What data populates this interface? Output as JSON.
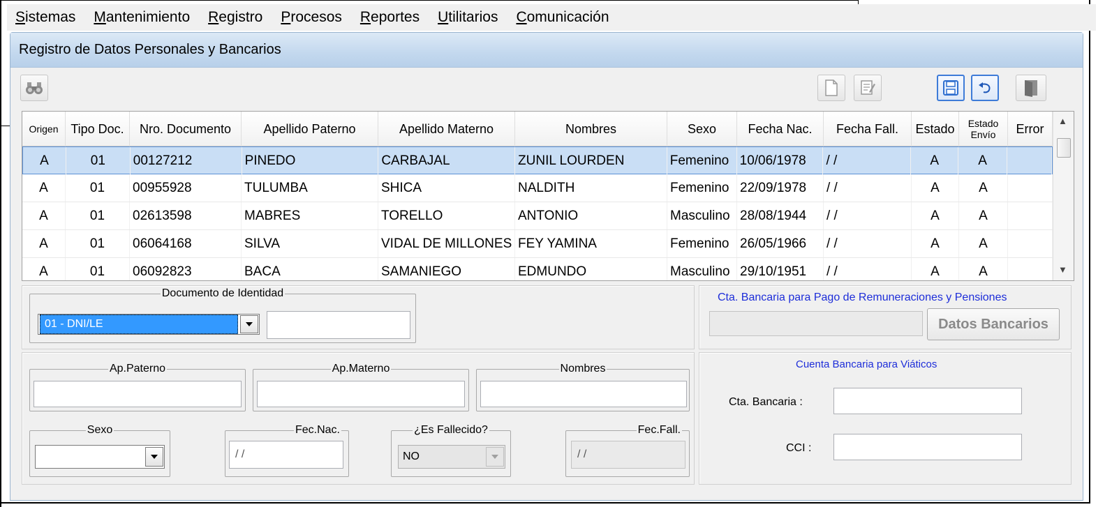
{
  "menu": [
    {
      "u": "S",
      "rest": "istemas"
    },
    {
      "u": "M",
      "rest": "antenimiento"
    },
    {
      "u": "R",
      "rest": "egistro"
    },
    {
      "u": "P",
      "rest": "rocesos"
    },
    {
      "u": "R",
      "rest": "eportes"
    },
    {
      "u": "U",
      "rest": "tilitarios"
    },
    {
      "u": "C",
      "rest": "omunicación"
    }
  ],
  "window": {
    "title": "Registro de Datos Personales y Bancarios"
  },
  "grid": {
    "headers": [
      "Origen",
      "Tipo Doc.",
      "Nro. Documento",
      "Apellido Paterno",
      "Apellido Materno",
      "Nombres",
      "Sexo",
      "Fecha Nac.",
      "Fecha Fall.",
      "Estado",
      "Estado Envío",
      "Error"
    ],
    "estado_envio_line1": "Estado",
    "estado_envio_line2": "Envío",
    "rows": [
      [
        "A",
        "01",
        "00127212",
        "PINEDO",
        "CARBAJAL",
        "ZUNIL LOURDEN",
        "Femenino",
        "10/06/1978",
        "/ /",
        "A",
        "A",
        ""
      ],
      [
        "A",
        "01",
        "00955928",
        "TULUMBA",
        "SHICA",
        "NALDITH",
        "Femenino",
        "22/09/1978",
        "/ /",
        "A",
        "A",
        ""
      ],
      [
        "A",
        "01",
        "02613598",
        "MABRES",
        "TORELLO",
        "ANTONIO",
        "Masculino",
        "28/08/1944",
        "/ /",
        "A",
        "A",
        ""
      ],
      [
        "A",
        "01",
        "06064168",
        "SILVA",
        "VIDAL DE MILLONES",
        "FEY YAMINA",
        "Femenino",
        "26/05/1966",
        "/ /",
        "A",
        "A",
        ""
      ],
      [
        "A",
        "01",
        "06092823",
        "BACA",
        "SAMANIEGO",
        "EDMUNDO",
        "Masculino",
        "29/10/1951",
        "/ /",
        "A",
        "A",
        ""
      ]
    ]
  },
  "doc_identidad": {
    "legend": "Documento de Identidad",
    "selected": "01  -  DNI/LE",
    "number": ""
  },
  "cta_remuneraciones": {
    "title": "Cta. Bancaria para Pago de Remuneraciones y Pensiones",
    "button": "Datos Bancarios",
    "value": ""
  },
  "personal": {
    "ap_paterno": "Ap.Paterno",
    "ap_materno": "Ap.Materno",
    "nombres": "Nombres",
    "sexo": "Sexo",
    "fec_nac": "Fec.Nac.",
    "fec_nac_value": "/ /",
    "es_fallecido": "¿Es Fallecido?",
    "es_fallecido_value": "NO",
    "fec_fall": "Fec.Fall.",
    "fec_fall_value": "/ /"
  },
  "viaticos": {
    "title": "Cuenta Bancaria para Viáticos",
    "cta_label": "Cta. Bancaria :",
    "cci_label": "CCI :"
  }
}
